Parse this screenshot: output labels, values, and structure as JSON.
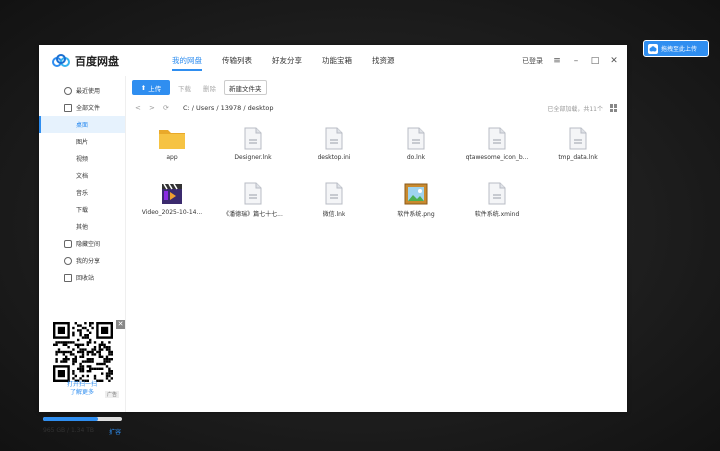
{
  "float_button": {
    "label": "拖拽至此上传"
  },
  "app": {
    "logo_text": "百度网盘",
    "tabs": [
      {
        "label": "我的网盘"
      },
      {
        "label": "传输列表"
      },
      {
        "label": "好友分享"
      },
      {
        "label": "功能宝箱"
      },
      {
        "label": "找资源"
      }
    ],
    "login": "已登录"
  },
  "sidebar": {
    "recent": "最近使用",
    "all_files": "全部文件",
    "sub_items": [
      "桌面",
      "图片",
      "视频",
      "文档",
      "音乐",
      "下载",
      "其他"
    ],
    "private_space": "隐藏空间",
    "my_share": "我的分享",
    "recycle": "回收站",
    "qr_caption_1": "打开扫一扫",
    "qr_caption_2": "了解更多",
    "ad_tag": "广告",
    "ad_close": "✕",
    "storage_text": "965 GB / 1.34 TB",
    "storage_fraction": 0.7,
    "expand": "扩容"
  },
  "toolbar": {
    "upload": "上传",
    "download": "下载",
    "delete": "删除",
    "new_folder": "新建文件夹"
  },
  "path": {
    "back": "<",
    "forward": ">",
    "refresh": "⟳",
    "text": "C: / Users / 13978 / desktop",
    "status": "已全部加载，共11个"
  },
  "files": [
    {
      "name": "app",
      "type": "folder"
    },
    {
      "name": "Designer.lnk",
      "type": "doc"
    },
    {
      "name": "desktop.ini",
      "type": "doc"
    },
    {
      "name": "do.lnk",
      "type": "doc"
    },
    {
      "name": "qtawesome_icon_b...",
      "type": "doc"
    },
    {
      "name": "tmp_data.lnk",
      "type": "doc"
    },
    {
      "name": "Video_2025-10-14...",
      "type": "video"
    },
    {
      "name": "《潘德瑞》篇七十七...",
      "type": "doc"
    },
    {
      "name": "微信.lnk",
      "type": "doc"
    },
    {
      "name": "软件系统.png",
      "type": "image"
    },
    {
      "name": "软件系统.xmind",
      "type": "doc"
    }
  ],
  "colors": {
    "accent": "#2f8ef0",
    "folder": "#f6c343"
  }
}
